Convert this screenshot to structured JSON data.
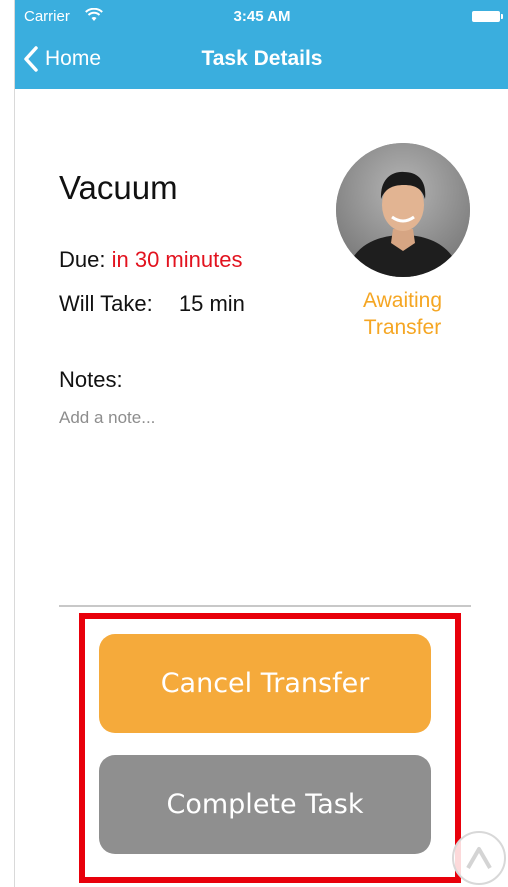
{
  "status_bar": {
    "carrier": "Carrier",
    "time": "3:45 AM"
  },
  "nav": {
    "back_label": "Home",
    "title": "Task Details"
  },
  "task": {
    "title": "Vacuum",
    "due_label": "Due:",
    "due_value": "in 30 minutes",
    "take_label": "Will Take:",
    "take_value": "15 min",
    "transfer_status_line1": "Awaiting",
    "transfer_status_line2": "Transfer"
  },
  "notes": {
    "label": "Notes:",
    "placeholder": "Add a note..."
  },
  "actions": {
    "cancel_transfer": "Cancel Transfer",
    "complete_task": "Complete Task"
  },
  "colors": {
    "nav_bar": "#3aaede",
    "due_text": "#e2131f",
    "status_text": "#f5a623",
    "cancel_button": "#f5aa3b",
    "complete_button": "#8f8f8f",
    "highlight": "#e8000b"
  },
  "icons": {
    "back": "chevron-left-icon",
    "wifi": "wifi-icon",
    "battery": "battery-icon",
    "scroll_up": "caret-up-icon"
  }
}
